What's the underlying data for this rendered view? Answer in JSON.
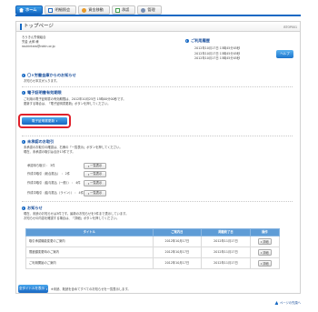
{
  "nav": {
    "tabs": [
      {
        "label": "ホーム",
        "icon": "home-icon",
        "active": true
      },
      {
        "label": "明細照会",
        "icon": "document-icon",
        "active": false
      },
      {
        "label": "資金移動",
        "icon": "yen-icon",
        "active": false
      },
      {
        "label": "承認",
        "icon": "check-icon",
        "active": false
      },
      {
        "label": "管理",
        "icon": "users-icon",
        "active": false
      }
    ]
  },
  "page": {
    "title": "トップページ",
    "code": "BTOP001"
  },
  "user": {
    "line1": "ろうきん労働組合",
    "line2": "労金 太郎 様",
    "line3": "roukintaro@rokin.or.jp"
  },
  "login_history": {
    "title": "ご利用履歴",
    "entries": [
      "2012年10月17日 15時45分05秒",
      "2012年10月17日 15時45分05秒",
      "2012年10月17日 15時45分05秒"
    ],
    "help_label": "ヘルプ"
  },
  "notice_ox": {
    "title": "〇×労働金庫からのお知らせ",
    "text": "お知らせ本文が入ります。"
  },
  "cert": {
    "title": "電子証明書有効期限",
    "text1": "ご利用の電子証明書の有効期限は、2012年10月25日 15時00分00秒です。",
    "text2": "更新する場合は、「電子証明書更新」ボタンを押してください。",
    "button_label": "電子証明書更新"
  },
  "pending": {
    "title": "未承認のお取引",
    "text1": "未承認のお取引の確認は、右側の「一覧表示」ボタンを押してください。",
    "text2": "現在、未承認の取引は合計13件です。",
    "rows": [
      {
        "label": "承認待ち取引 ： 3件",
        "button": "一覧表示"
      },
      {
        "label": "作成中取引（総合振込） ： 2件",
        "button": "一覧表示"
      },
      {
        "label": "作成中取引（給与振込（一般）） ： 4件",
        "button": "一覧表示"
      },
      {
        "label": "作成中取引（給与振込（ライン）） ： 4件",
        "button": "一覧表示"
      }
    ]
  },
  "news": {
    "title": "お知らせ",
    "text1": "現在、未読のお知らせは3件です。最新のお知らせを5件まで表示しています。",
    "text2": "お知らせの内容を確認する場合は、「詳細」ボタンを押してください。",
    "headers": [
      "タイトル",
      "ご案内日",
      "掲載終了日",
      "操作"
    ],
    "rows": [
      {
        "title": "取引承認機能変更のご案内",
        "date": "2012年10月17日",
        "end": "2012年11月17日",
        "action": "詳細"
      },
      {
        "title": "限度額変更時のご案内",
        "date": "2012年10月17日",
        "end": "2012年11月17日",
        "action": "詳細"
      },
      {
        "title": "ご利用開始のご案内",
        "date": "2012年10月17日",
        "end": "2012年11月17日",
        "action": "詳細"
      }
    ],
    "all_button": "全タイトルを表示",
    "all_note": "※未読、既読を含めてすべてのお知らせを一覧表示します。"
  },
  "footer": {
    "to_top": "ページの先頭へ"
  }
}
